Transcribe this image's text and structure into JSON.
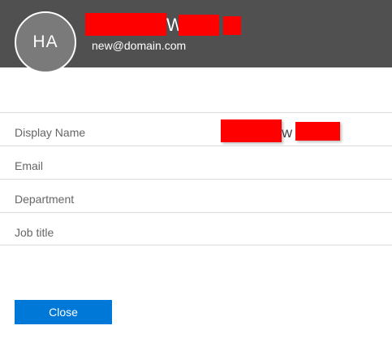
{
  "header": {
    "avatar_initials": "HA",
    "name_visible_fragment": "W",
    "email": "new@domain.com"
  },
  "fields": [
    {
      "label": "Display Name",
      "value_fragment": "W"
    },
    {
      "label": "Email",
      "value_fragment": ""
    },
    {
      "label": "Department",
      "value_fragment": ""
    },
    {
      "label": "Job title",
      "value_fragment": ""
    }
  ],
  "actions": {
    "close_label": "Close"
  },
  "colors": {
    "header_bg": "#505050",
    "avatar_bg": "#7a7a7a",
    "redaction": "#ff0000",
    "primary_button": "#0078d7",
    "divider": "#dcdcdc"
  }
}
